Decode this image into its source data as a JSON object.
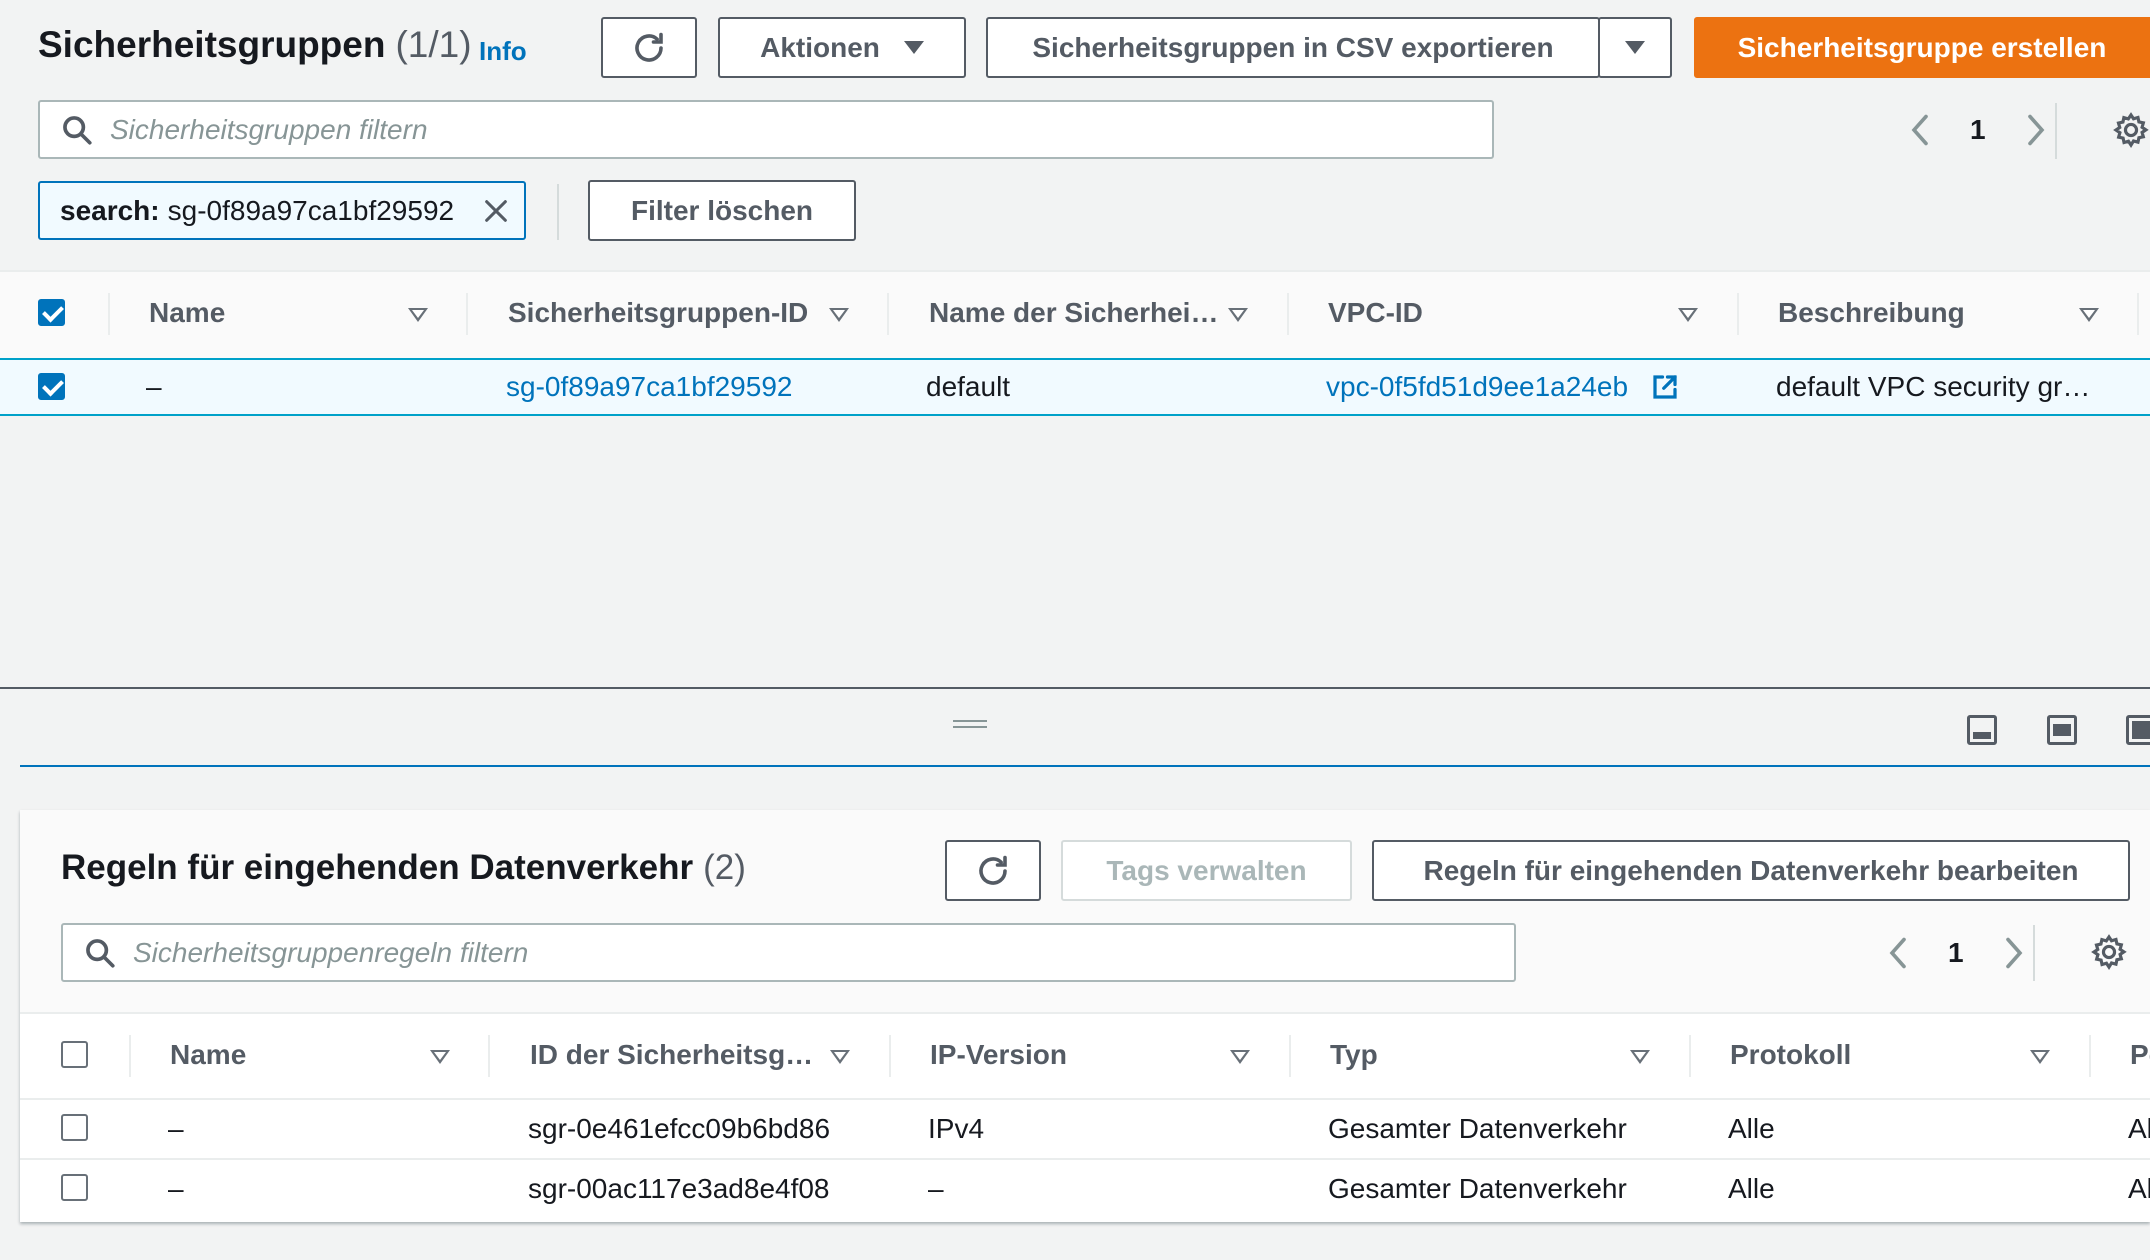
{
  "header": {
    "title": "Sicherheitsgruppen",
    "count": "(1/1)",
    "info_label": "Info",
    "actions_label": "Aktionen",
    "export_label": "Sicherheitsgruppen in CSV exportieren",
    "create_label": "Sicherheitsgruppe erstellen"
  },
  "filter": {
    "placeholder": "Sicherheitsgruppen filtern",
    "token_key": "search:",
    "token_value": "sg-0f89a97ca1bf29592",
    "clear_label": "Filter löschen"
  },
  "pagination": {
    "page": "1"
  },
  "table": {
    "columns": [
      "Name",
      "Sicherheitsgruppen-ID",
      "Name der Sicherhei…",
      "VPC-ID",
      "Beschreibung"
    ],
    "rows": [
      {
        "name": "–",
        "id": "sg-0f89a97ca1bf29592",
        "group_name": "default",
        "vpc_id": "vpc-0f5fd51d9ee1a24eb",
        "description": "default VPC security gr…",
        "selected": true
      }
    ]
  },
  "inbound": {
    "title": "Regeln für eingehenden Datenverkehr",
    "count": "(2)",
    "tags_label": "Tags verwalten",
    "edit_label": "Regeln für eingehenden Datenverkehr bearbeiten",
    "filter_placeholder": "Sicherheitsgruppenregeln filtern",
    "page": "1",
    "columns": [
      "Name",
      "ID der Sicherheitsg…",
      "IP-Version",
      "Typ",
      "Protokoll",
      "Po"
    ],
    "rows": [
      {
        "name": "–",
        "rule_id": "sgr-0e461efcc09b6bd86",
        "ip_version": "IPv4",
        "type": "Gesamter Datenverkehr",
        "protocol": "Alle",
        "port": "Al"
      },
      {
        "name": "–",
        "rule_id": "sgr-00ac117e3ad8e4f08",
        "ip_version": "–",
        "type": "Gesamter Datenverkehr",
        "protocol": "Alle",
        "port": "Al"
      }
    ]
  },
  "colors": {
    "accent": "#0073bb",
    "primary_button": "#ec7211",
    "background": "#f2f3f3"
  },
  "icons": [
    "refresh-icon",
    "caret-down-icon",
    "search-icon",
    "chevron-left-icon",
    "chevron-right-icon",
    "settings-icon",
    "close-icon",
    "external-link-icon",
    "drag-handle-icon",
    "panel-bottom-icon",
    "panel-side-icon"
  ]
}
